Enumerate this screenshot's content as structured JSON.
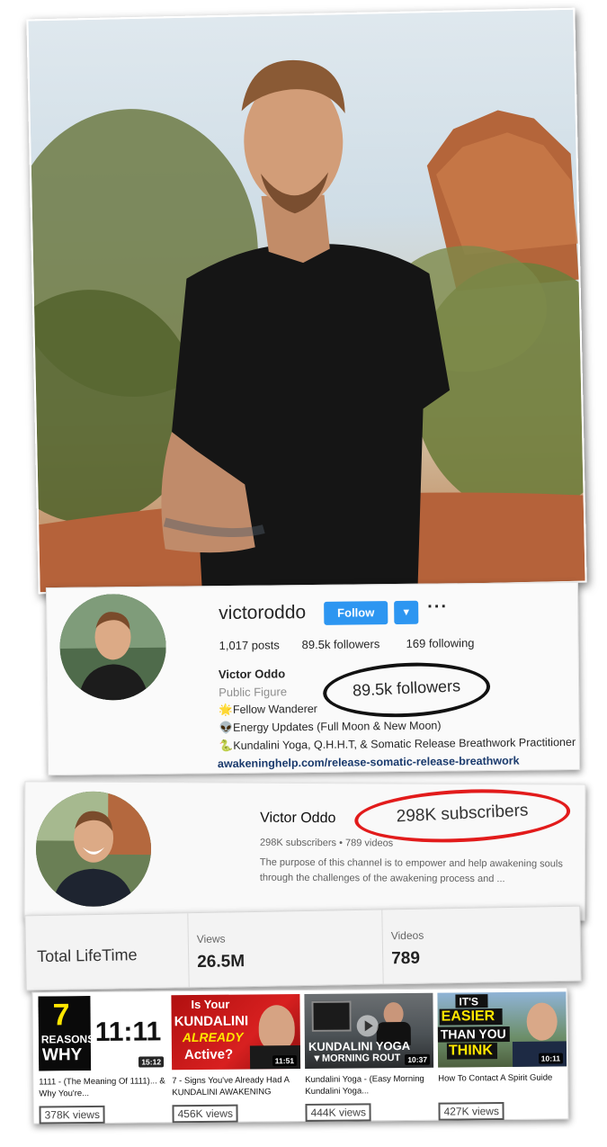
{
  "instagram": {
    "username": "victoroddo",
    "follow_label": "Follow",
    "dropdown_icon": "chevron-down-icon",
    "more_icon": "more-horizontal-icon",
    "posts": "1,017 posts",
    "followers": "89.5k followers",
    "following": "169 following",
    "name": "Victor Oddo",
    "category": "Public Figure",
    "bio": [
      "🌟Fellow Wanderer",
      "👽Energy Updates (Full Moon & New Moon)",
      "🐍Kundalini Yoga, Q.H.H.T, & Somatic Release Breathwork Practitioner"
    ],
    "link": "awakeninghelp.com/release-somatic-release-breathwork",
    "highlight": "89.5k followers"
  },
  "youtube": {
    "channel_name": "Victor Oddo",
    "highlight": "298K subscribers",
    "meta": "298K subscribers • 789 videos",
    "description": "The purpose of this channel is to empower and help awakening souls through the challenges of the awakening process and ..."
  },
  "stats": {
    "total_label": "Total LifeTime",
    "views_label": "Views",
    "views_value": "26.5M",
    "videos_label": "Videos",
    "videos_value": "789"
  },
  "videos": [
    {
      "title": "1111 - (The Meaning Of 1111)... & Why You're...",
      "views": "378K views",
      "duration": "15:12",
      "overlay": [
        "7",
        "REASONS",
        "WHY",
        "11:11"
      ]
    },
    {
      "title": "7 - Signs You've Already Had A KUNDALINI AWAKENING",
      "views": "456K views",
      "duration": "11:51",
      "overlay": [
        "Is Your",
        "KUNDALINI",
        "ALREADY",
        "Active?"
      ]
    },
    {
      "title": "Kundalini Yoga - (Easy Morning Kundalini Yoga...",
      "views": "444K views",
      "duration": "10:37",
      "overlay": [
        "KUNDALINI YOGA",
        "▼MORNING ROUT"
      ]
    },
    {
      "title": "How To Contact A Spirit Guide",
      "views": "427K views",
      "duration": "10:11",
      "overlay": [
        "IT'S",
        "EASIER",
        "THAN YOU",
        "THINK"
      ]
    }
  ],
  "colors": {
    "follow_blue": "#2d96f1",
    "subscriber_circle": "#e21b1b",
    "link_blue": "#1a3a6d"
  }
}
